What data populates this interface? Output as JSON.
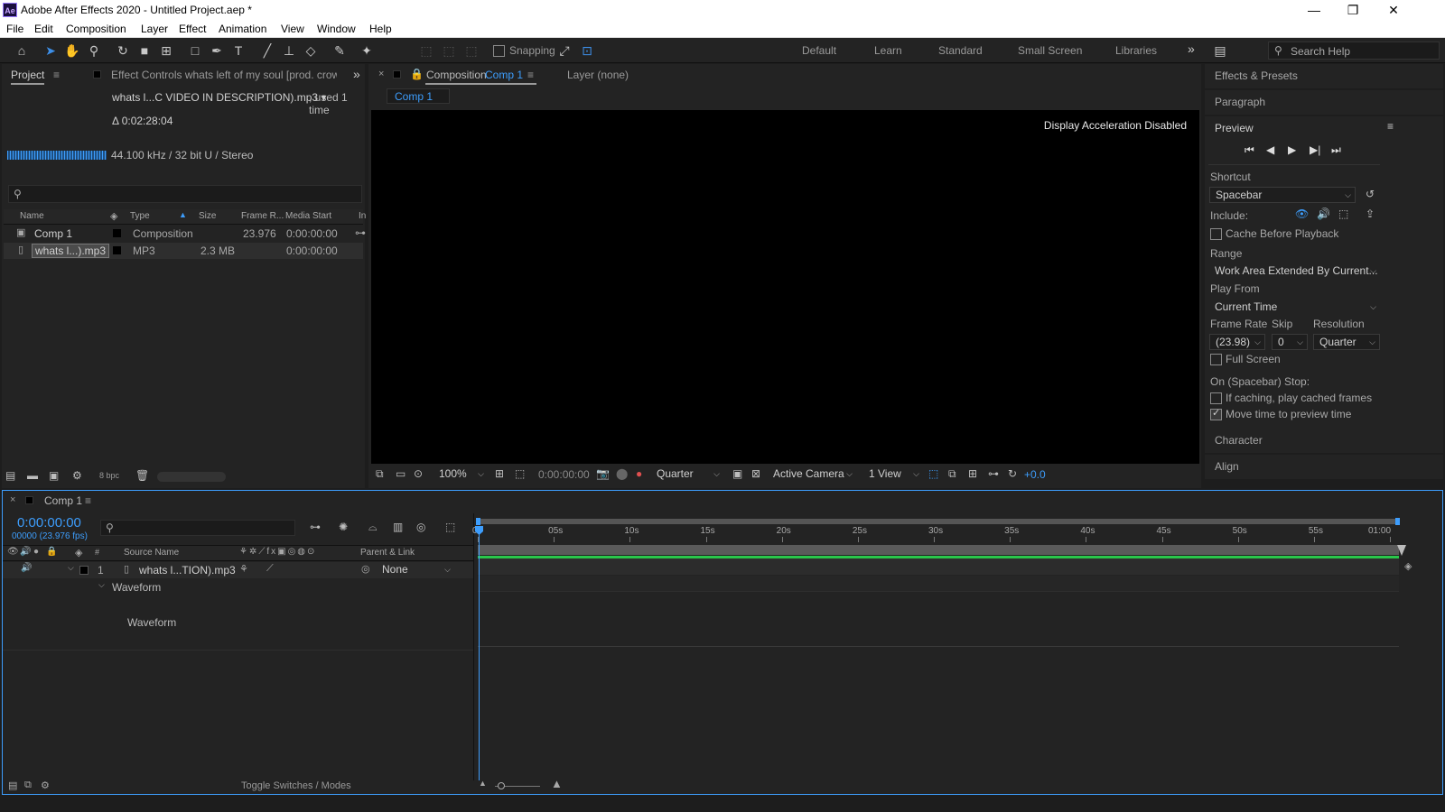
{
  "window": {
    "logo_text": "Ae",
    "title": "Adobe After Effects 2020 - Untitled Project.aep *",
    "minimize": "—",
    "restore": "❐",
    "close": "✕"
  },
  "menu": [
    "File",
    "Edit",
    "Composition",
    "Layer",
    "Effect",
    "Animation",
    "View",
    "Window",
    "Help"
  ],
  "toolbar": {
    "snapping_label": "Snapping",
    "workspaces": [
      "Default",
      "Learn",
      "Standard",
      "Small Screen",
      "Libraries"
    ],
    "more": "»",
    "search_placeholder": "Search Help"
  },
  "project_panel": {
    "tab_project": "Project",
    "tab_effect_controls": "Effect Controls whats left of my soul [prod. crowly]",
    "selected_file": "whats l...C VIDEO IN DESCRIPTION).mp3 ▾",
    "used_text": ", used 1 time",
    "duration": "Δ 0:02:28:04",
    "audio_info": "44.100 kHz / 32 bit U / Stereo",
    "columns": [
      "Name",
      "Type",
      "Size",
      "Frame R...",
      "Media Start",
      "In"
    ],
    "rows": [
      {
        "name": "Comp 1",
        "type": "Composition",
        "size": "",
        "frame_rate": "23.976",
        "media_start": "0:00:00:00"
      },
      {
        "name": "whats l...).mp3",
        "type": "MP3",
        "size": "2.3 MB",
        "frame_rate": "",
        "media_start": "0:00:00:00"
      }
    ],
    "bpc": "8 bpc"
  },
  "comp_panel": {
    "tab_label": "Composition",
    "tab_comp_name": "Comp 1",
    "layer_tab": "Layer (none)",
    "sub_tab": "Comp 1",
    "display_message": "Display Acceleration Disabled",
    "zoom": "100%",
    "timecode": "0:00:00:00",
    "resolution": "Quarter",
    "camera": "Active Camera",
    "views": "1 View",
    "exposure": "+0.0"
  },
  "right_panel": {
    "effects_presets": "Effects & Presets",
    "paragraph": "Paragraph",
    "preview": "Preview",
    "shortcut_label": "Shortcut",
    "shortcut_value": "Spacebar",
    "include_label": "Include:",
    "cache_before_playback": "Cache Before Playback",
    "range_label": "Range",
    "range_value": "Work Area Extended By Current...",
    "play_from_label": "Play From",
    "play_from_value": "Current Time",
    "frame_rate_label": "Frame Rate",
    "skip_label": "Skip",
    "resolution_label": "Resolution",
    "frame_rate_value": "(23.98)",
    "skip_value": "0",
    "resolution_value": "Quarter",
    "full_screen": "Full Screen",
    "on_stop_label": "On (Spacebar) Stop:",
    "if_caching": "If caching, play cached frames",
    "move_time": "Move time to preview time",
    "character": "Character",
    "align": "Align"
  },
  "timeline": {
    "tab": "Comp 1",
    "timecode": "0:00:00:00",
    "frames": "00000 (23.976 fps)",
    "col_hash": "#",
    "col_source": "Source Name",
    "col_parent": "Parent & Link",
    "layer_number": "1",
    "layer_name": "whats l...TION).mp3",
    "parent_value": "None",
    "waveform_group": "Waveform",
    "waveform_prop": "Waveform",
    "toggle_label": "Toggle Switches / Modes",
    "ruler": [
      "0s",
      "05s",
      "10s",
      "15s",
      "20s",
      "25s",
      "30s",
      "35s",
      "40s",
      "45s",
      "50s",
      "55s",
      "01:00"
    ]
  },
  "colors": {
    "accent_blue": "#3d9dfc",
    "panel_bg": "#232323",
    "workarea_green": "#29c64a"
  }
}
